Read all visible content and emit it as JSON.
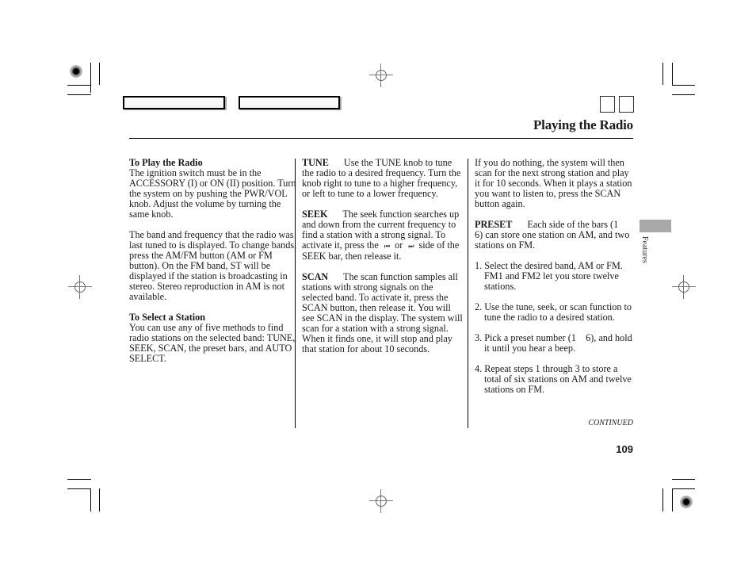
{
  "page": {
    "title": "Playing the Radio",
    "section_tab": "Features",
    "continued": "CONTINUED",
    "page_number": "109"
  },
  "columns": {
    "left": {
      "heading1": "To Play the Radio",
      "para1": "The ignition switch must be in the ACCESSORY (I) or ON (II) position. Turn the system on by pushing the PWR/VOL knob. Adjust the volume by turning the same knob.",
      "para2": "The band and frequency that the radio was last tuned to is displayed. To change bands, press the AM/FM button (AM or FM button). On the FM band, ST will be displayed if the station is broadcasting in stereo. Stereo reproduction in AM is not available.",
      "heading2": "To Select a Station",
      "para3": "You can use any of five methods to find radio stations on the selected band: TUNE, SEEK, SCAN, the preset bars, and AUTO SELECT."
    },
    "middle": {
      "tune_label": "TUNE",
      "tune_text": "Use the TUNE knob to tune the radio to a desired frequency. Turn the knob right to tune to a higher frequency, or left to tune to a lower frequency.",
      "seek_label": "SEEK",
      "seek_text_a": "The seek function searches up and down from the current frequency to find a station with a strong signal. To activate it, press the",
      "seek_icon_prev": "⏮",
      "seek_or": "or",
      "seek_icon_next": "⏭",
      "seek_text_b": "side of the SEEK bar, then release it.",
      "scan_label": "SCAN",
      "scan_text": "The scan function samples all stations with strong signals on the selected band. To activate it, press the SCAN button, then release it. You will see SCAN in the display. The system will scan for a station with a strong signal. When it finds one, it will stop and play that station for about 10 seconds."
    },
    "right": {
      "para1": "If you do nothing, the system will then scan for the next strong station and play it for 10 seconds. When it plays a station you want to listen to, press the SCAN button again.",
      "preset_label": "PRESET",
      "preset_text": "Each side of the bars (1    6) can store one station on AM, and two stations on FM.",
      "steps": [
        "1. Select the desired band, AM or FM. FM1 and FM2 let you store twelve stations.",
        "2. Use the tune, seek, or scan function to tune the radio to a desired station.",
        "3. Pick a preset number (1    6), and hold it until you hear a beep.",
        "4. Repeat steps 1 through 3 to store a total of six stations on AM and twelve stations on FM."
      ]
    }
  }
}
